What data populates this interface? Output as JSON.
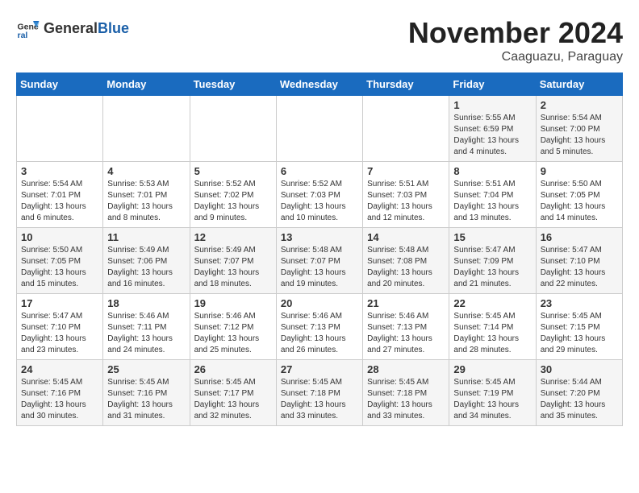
{
  "header": {
    "logo_general": "General",
    "logo_blue": "Blue",
    "title": "November 2024",
    "subtitle": "Caaguazu, Paraguay"
  },
  "days_of_week": [
    "Sunday",
    "Monday",
    "Tuesday",
    "Wednesday",
    "Thursday",
    "Friday",
    "Saturday"
  ],
  "weeks": [
    [
      {
        "day": "",
        "detail": ""
      },
      {
        "day": "",
        "detail": ""
      },
      {
        "day": "",
        "detail": ""
      },
      {
        "day": "",
        "detail": ""
      },
      {
        "day": "",
        "detail": ""
      },
      {
        "day": "1",
        "detail": "Sunrise: 5:55 AM\nSunset: 6:59 PM\nDaylight: 13 hours\nand 4 minutes."
      },
      {
        "day": "2",
        "detail": "Sunrise: 5:54 AM\nSunset: 7:00 PM\nDaylight: 13 hours\nand 5 minutes."
      }
    ],
    [
      {
        "day": "3",
        "detail": "Sunrise: 5:54 AM\nSunset: 7:01 PM\nDaylight: 13 hours\nand 6 minutes."
      },
      {
        "day": "4",
        "detail": "Sunrise: 5:53 AM\nSunset: 7:01 PM\nDaylight: 13 hours\nand 8 minutes."
      },
      {
        "day": "5",
        "detail": "Sunrise: 5:52 AM\nSunset: 7:02 PM\nDaylight: 13 hours\nand 9 minutes."
      },
      {
        "day": "6",
        "detail": "Sunrise: 5:52 AM\nSunset: 7:03 PM\nDaylight: 13 hours\nand 10 minutes."
      },
      {
        "day": "7",
        "detail": "Sunrise: 5:51 AM\nSunset: 7:03 PM\nDaylight: 13 hours\nand 12 minutes."
      },
      {
        "day": "8",
        "detail": "Sunrise: 5:51 AM\nSunset: 7:04 PM\nDaylight: 13 hours\nand 13 minutes."
      },
      {
        "day": "9",
        "detail": "Sunrise: 5:50 AM\nSunset: 7:05 PM\nDaylight: 13 hours\nand 14 minutes."
      }
    ],
    [
      {
        "day": "10",
        "detail": "Sunrise: 5:50 AM\nSunset: 7:05 PM\nDaylight: 13 hours\nand 15 minutes."
      },
      {
        "day": "11",
        "detail": "Sunrise: 5:49 AM\nSunset: 7:06 PM\nDaylight: 13 hours\nand 16 minutes."
      },
      {
        "day": "12",
        "detail": "Sunrise: 5:49 AM\nSunset: 7:07 PM\nDaylight: 13 hours\nand 18 minutes."
      },
      {
        "day": "13",
        "detail": "Sunrise: 5:48 AM\nSunset: 7:07 PM\nDaylight: 13 hours\nand 19 minutes."
      },
      {
        "day": "14",
        "detail": "Sunrise: 5:48 AM\nSunset: 7:08 PM\nDaylight: 13 hours\nand 20 minutes."
      },
      {
        "day": "15",
        "detail": "Sunrise: 5:47 AM\nSunset: 7:09 PM\nDaylight: 13 hours\nand 21 minutes."
      },
      {
        "day": "16",
        "detail": "Sunrise: 5:47 AM\nSunset: 7:10 PM\nDaylight: 13 hours\nand 22 minutes."
      }
    ],
    [
      {
        "day": "17",
        "detail": "Sunrise: 5:47 AM\nSunset: 7:10 PM\nDaylight: 13 hours\nand 23 minutes."
      },
      {
        "day": "18",
        "detail": "Sunrise: 5:46 AM\nSunset: 7:11 PM\nDaylight: 13 hours\nand 24 minutes."
      },
      {
        "day": "19",
        "detail": "Sunrise: 5:46 AM\nSunset: 7:12 PM\nDaylight: 13 hours\nand 25 minutes."
      },
      {
        "day": "20",
        "detail": "Sunrise: 5:46 AM\nSunset: 7:13 PM\nDaylight: 13 hours\nand 26 minutes."
      },
      {
        "day": "21",
        "detail": "Sunrise: 5:46 AM\nSunset: 7:13 PM\nDaylight: 13 hours\nand 27 minutes."
      },
      {
        "day": "22",
        "detail": "Sunrise: 5:45 AM\nSunset: 7:14 PM\nDaylight: 13 hours\nand 28 minutes."
      },
      {
        "day": "23",
        "detail": "Sunrise: 5:45 AM\nSunset: 7:15 PM\nDaylight: 13 hours\nand 29 minutes."
      }
    ],
    [
      {
        "day": "24",
        "detail": "Sunrise: 5:45 AM\nSunset: 7:16 PM\nDaylight: 13 hours\nand 30 minutes."
      },
      {
        "day": "25",
        "detail": "Sunrise: 5:45 AM\nSunset: 7:16 PM\nDaylight: 13 hours\nand 31 minutes."
      },
      {
        "day": "26",
        "detail": "Sunrise: 5:45 AM\nSunset: 7:17 PM\nDaylight: 13 hours\nand 32 minutes."
      },
      {
        "day": "27",
        "detail": "Sunrise: 5:45 AM\nSunset: 7:18 PM\nDaylight: 13 hours\nand 33 minutes."
      },
      {
        "day": "28",
        "detail": "Sunrise: 5:45 AM\nSunset: 7:18 PM\nDaylight: 13 hours\nand 33 minutes."
      },
      {
        "day": "29",
        "detail": "Sunrise: 5:45 AM\nSunset: 7:19 PM\nDaylight: 13 hours\nand 34 minutes."
      },
      {
        "day": "30",
        "detail": "Sunrise: 5:44 AM\nSunset: 7:20 PM\nDaylight: 13 hours\nand 35 minutes."
      }
    ]
  ]
}
